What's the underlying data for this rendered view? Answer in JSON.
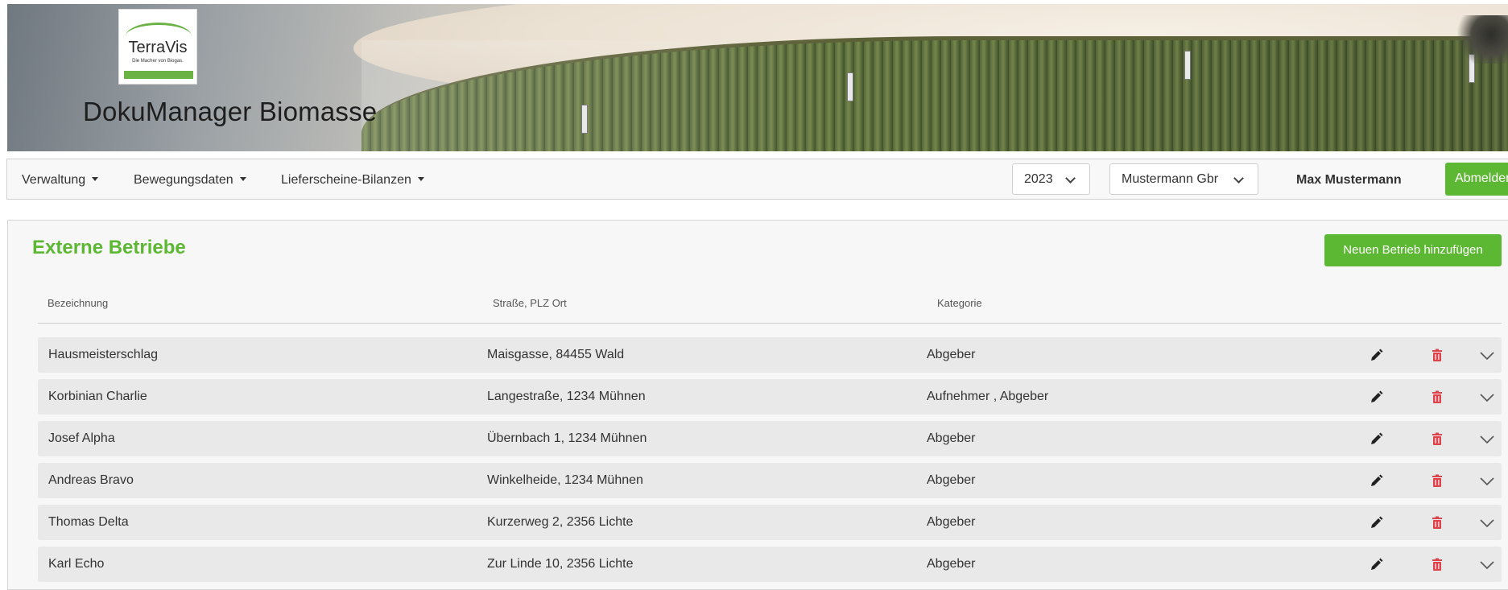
{
  "header": {
    "logo": {
      "brand": "TerraVis",
      "tagline": "Die Macher von Biogas."
    },
    "app_title": "DokuManager Biomasse"
  },
  "navbar": {
    "menus": [
      "Verwaltung",
      "Bewegungsdaten",
      "Lieferscheine-Bilanzen"
    ],
    "year_select": {
      "value": "2023"
    },
    "company_select": {
      "value": "Mustermann Gbr"
    },
    "user_name": "Max Mustermann",
    "logout_label": "Abmelden"
  },
  "panel": {
    "title": "Externe Betriebe",
    "add_button_label": "Neuen Betrieb hinzufügen",
    "columns": [
      "Bezeichnung",
      "Straße, PLZ Ort",
      "Kategorie"
    ],
    "rows": [
      {
        "name": "Hausmeisterschlag",
        "address": "Maisgasse, 84455 Wald",
        "category": "Abgeber"
      },
      {
        "name": "Korbinian Charlie",
        "address": "Langestraße, 1234 Mühnen",
        "category": "Aufnehmer , Abgeber"
      },
      {
        "name": "Josef Alpha",
        "address": "Übernbach 1, 1234 Mühnen",
        "category": "Abgeber"
      },
      {
        "name": "Andreas Bravo",
        "address": "Winkelheide, 1234 Mühnen",
        "category": "Abgeber"
      },
      {
        "name": "Thomas Delta",
        "address": "Kurzerweg 2, 2356 Lichte",
        "category": "Abgeber"
      },
      {
        "name": "Karl Echo",
        "address": "Zur Linde 10, 2356 Lichte",
        "category": "Abgeber"
      }
    ],
    "row_icons": [
      "pencil-icon",
      "trash-icon",
      "chevron-down-icon"
    ]
  },
  "colors": {
    "accent_green": "#5cb832",
    "delete_red": "#e0424b",
    "row_background": "#e9e9e9",
    "panel_background": "#f7f7f7"
  }
}
